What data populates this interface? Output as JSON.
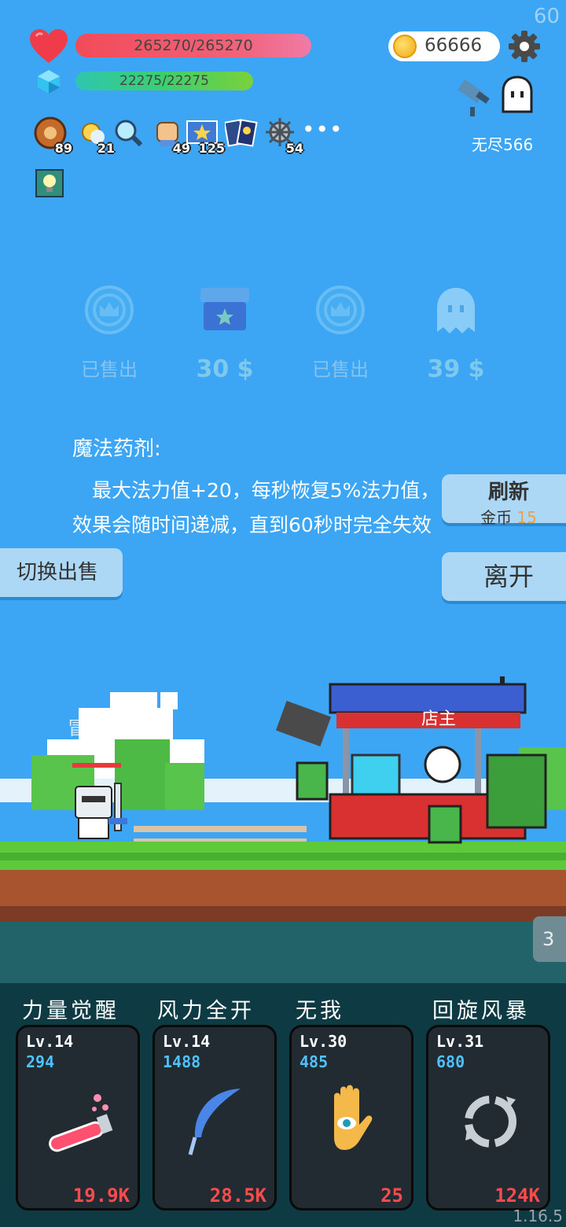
{
  "fps": "60",
  "stats": {
    "hp": "265270/265270",
    "mp": "22275/22275",
    "coins": "66666",
    "mode": "无尽566"
  },
  "buffs": [
    {
      "icon": "wheel-icon",
      "count": "89"
    },
    {
      "icon": "sun-icon",
      "count": "21"
    },
    {
      "icon": "magnifier-icon",
      "count": ""
    },
    {
      "icon": "fist-icon",
      "count": "49"
    },
    {
      "icon": "star-card-icon",
      "count": "125"
    },
    {
      "icon": "tarot-cards-icon",
      "count": ""
    },
    {
      "icon": "spiky-ball-icon",
      "count": "54"
    }
  ],
  "buffs_more": "•••",
  "shop": {
    "slots": [
      {
        "icon": "crown-icon",
        "text": "已售出",
        "sold": true
      },
      {
        "icon": "chest-icon",
        "text": "30 $",
        "sold": false
      },
      {
        "icon": "crown-icon",
        "text": "已售出",
        "sold": true
      },
      {
        "icon": "ghost-icon",
        "text": "39 $",
        "sold": false
      }
    ],
    "item_title": "魔法药剂:",
    "item_desc": "最大法力值+20，每秒恢复5%法力值，效果会随时间递减，直到60秒时完全失效",
    "refresh_label": "刷新",
    "refresh_cost_label": "金币",
    "refresh_cost_value": "15",
    "leave_label": "离开",
    "switch_label": "切换出售",
    "owner_label": "店主",
    "adventurer_label": "冒险"
  },
  "side_tab": "3",
  "skills": [
    {
      "name": "力量觉醒",
      "level": "Lv.14",
      "mana": "294",
      "cost": "19.9K",
      "icon": "potion-icon"
    },
    {
      "name": "风力全开",
      "level": "Lv.14",
      "mana": "1488",
      "cost": "28.5K",
      "icon": "feather-icon"
    },
    {
      "name": "无我",
      "level": "Lv.30",
      "mana": "485",
      "cost": "25",
      "icon": "eye-hand-icon"
    },
    {
      "name": "回旋风暴",
      "level": "Lv.31",
      "mana": "680",
      "cost": "124K",
      "icon": "cyclone-icon"
    }
  ],
  "version": "1.16.5",
  "colors": {
    "sky": "#3ca6f5",
    "hp": "#f24b58",
    "mp": "#3ccf6d",
    "cost": "#ff4b4b",
    "mana": "#4fc1ff"
  }
}
